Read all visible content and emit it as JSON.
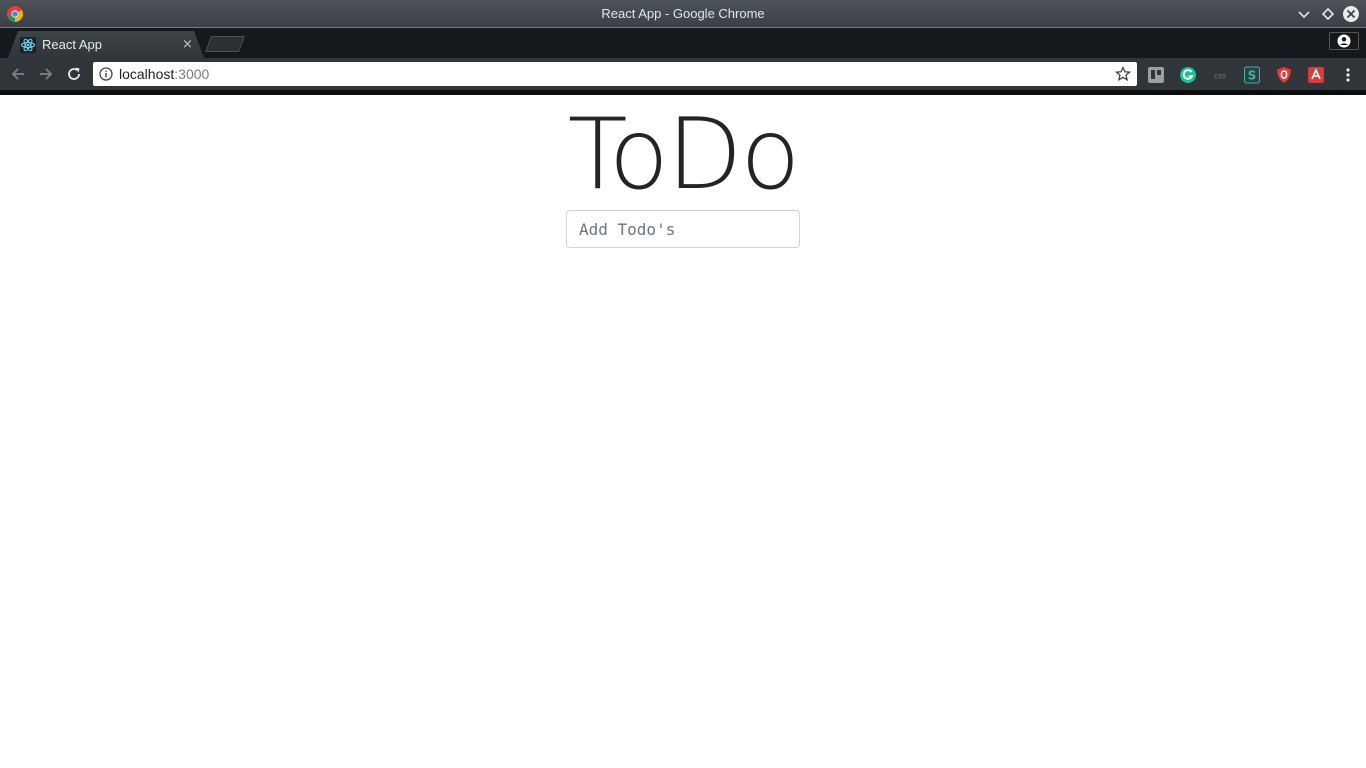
{
  "window": {
    "title": "React App - Google Chrome"
  },
  "tabs": [
    {
      "label": "React App",
      "close_glyph": "×",
      "active": true
    }
  ],
  "addressbar": {
    "host": "localhost",
    "port": ":3000"
  },
  "extensions": [
    "trello-icon",
    "grammarly-icon",
    "css-icon",
    "stylus-icon",
    "ublock-icon",
    "extension-red-icon"
  ],
  "page": {
    "heading": "ToDo",
    "input": {
      "placeholder": "Add Todo's",
      "value": ""
    }
  },
  "colors": {
    "accent": "#2f8fc4",
    "grammarly": "#15c39a",
    "ublock": "#e53935"
  }
}
